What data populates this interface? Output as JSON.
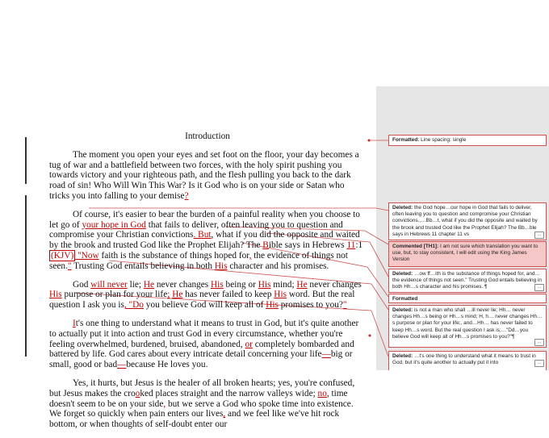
{
  "document": {
    "title": "Introduction",
    "p1": "The moment you open your eyes and set foot on the floor, your day becomes a tug of war and a battlefield between two forces, with the holy spirit pushing you towards victory and your righteous path, and the flesh pulling you back to the dark road of sin! Who Will Win This War? Is it God who is on your side or Satan who tricks you into falling to your demise",
    "p1_end": "?",
    "p2_a": "Of course, it's easier to bear the burden of a painful reality when you choose to let go of ",
    "p2_ins1": "your hope in God",
    "p2_b": " that fails to deliver, often leaving you to question and compromise your Christian convictions",
    "p2_ins2": ". But",
    "p2_c": ", what if you did the opposite and waited by the brook and trusted God like the Prophet Elijah? The ",
    "p2_ins3": "B",
    "p2_d": "ible says in Hebrews ",
    "p2_ins4": "11",
    "p2_e": ":1 ",
    "p2_hl": "(KJV)",
    "p2_ins5": " \"Now",
    "p2_f": " faith is the substance of things hoped for",
    "p2_ins6": ",",
    "p2_g": " the evidence of things not seen.",
    "p2_ins7": "\"",
    "p2_h": " Trusting God entails believing in both ",
    "p2_ins8": "His",
    "p2_i": " character and his promises.",
    "p3_a": "God ",
    "p3_ins1": "will never",
    "p3_b": " lie; ",
    "p3_ins2": "He",
    "p3_c": " never changes ",
    "p3_ins3": "His",
    "p3_d": " being or ",
    "p3_ins4": "His",
    "p3_e": " mind; ",
    "p3_ins5": "He",
    "p3_f": " never changes ",
    "p3_ins6": "His",
    "p3_g": " purpose or plan for your life",
    "p3_ins7": ";",
    "p3_h": " ",
    "p3_ins8": "He",
    "p3_i": " has never failed to keep ",
    "p3_ins9": "His",
    "p3_j": " word. But the real question I ask you is",
    "p3_ins10": ", \"Do",
    "p3_k": " you believe God will keep all of ",
    "p3_ins11": "His",
    "p3_l": " promises to you?",
    "p3_ins12": "\"",
    "p4_ins1": "I",
    "p4_a": "t's one thing to understand what it means to trust in God, but it's quite another to actually put it into action and trust God in every circumstance, whether you're feeling overwhelmed, burdened, bruised, abandoned, ",
    "p4_ins2": "or",
    "p4_b": " completely bombarded and battered by life. God cares about every intricate detail concerning your life",
    "p4_ins3": "—",
    "p4_c": "big or small, good or bad",
    "p4_ins4": "—",
    "p4_d": "because He loves you.",
    "p5_a": "Yes, it hurts, but Jesus is the healer of all broken hearts; yes, you're confused, but Jesus makes the cro",
    "p5_ins1": "o",
    "p5_b": "ked places straight and the narrow valleys wide; ",
    "p5_ins2": "no",
    "p5_c": ", time doesn't seem to be on your side",
    "p5_ins3": ",",
    "p5_d": " but we serve a God who spoke time into existence. We forget so quickly when pain enters our lives",
    "p5_ins4": ",",
    "p5_e": " and we feel like we've hit rock bottom, or when thoughts of self-doubt enter our"
  },
  "balloons": [
    {
      "label": "Formatted:",
      "text": " Line spacing:  single"
    },
    {
      "label": "Deleted:",
      "text": " the God hope…our hope in God that fails to deliver, often leaving you to question and compromise your Christian convictions.,…Bb…t, what if you did the opposite and waited by the brook and trusted God like the Prophet Elijah? The Bb…ble says in Hebrews 11 chapter 11 vs"
    },
    {
      "label": "Commented [TH1]:",
      "text": " I am not sure which translation you want to use, but, to stay consistent, I will edit using the King James Version"
    },
    {
      "label": "Deleted:",
      "text": " …ow ff…ith is the substance of things hoped for, and…the evidence of things not seen.\" Trusting God entails believing in both Hh…s character and his promises. ¶"
    },
    {
      "label": "Formatted",
      "text": ""
    },
    {
      "label": "Deleted:",
      "text": " is not a man who shall …ill never lie; Hh… never changes Hh…s being or Hh…s mind; H, h… never changes Hh…s purpose or plan for your life;, and…Hh… has never failed to keep Hh…s word. But the real question I ask is;…\"Dd…you believe God will keep all of Hh…s promises to you?\"¶"
    },
    {
      "label": "Deleted:",
      "text": " …t's one thing to understand what it means to trust in God, but it's quite another to actually put it into"
    }
  ],
  "colors": {
    "revision": "#c00000",
    "balloon_border": "#d05050",
    "comment_fill": "#f5c7c7",
    "margin_pane": "#e7e6e6"
  }
}
